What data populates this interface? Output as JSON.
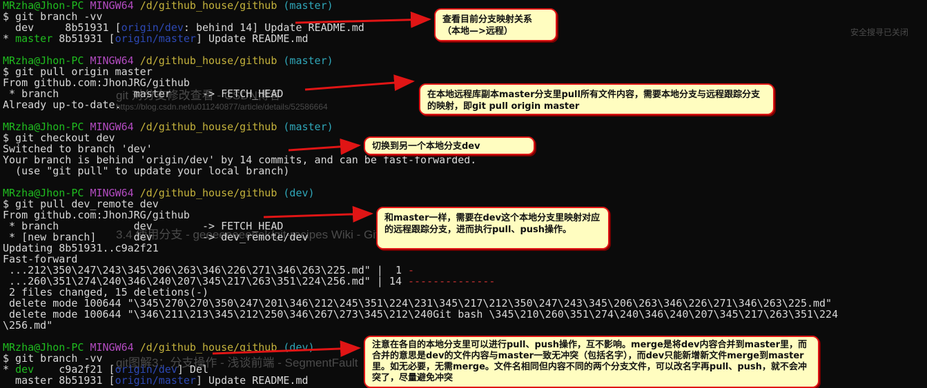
{
  "terminal": {
    "lines": [
      {
        "name": "prompt-line",
        "segs": [
          [
            "MRzha@Jhon-PC ",
            "g"
          ],
          [
            "MINGW64 ",
            "m"
          ],
          [
            "/d/github_house/github ",
            "y"
          ],
          [
            "(master)",
            "c"
          ]
        ]
      },
      {
        "name": "command-line",
        "segs": [
          [
            "$ git branch -vv",
            "w"
          ]
        ]
      },
      {
        "name": "output-line",
        "segs": [
          [
            "  dev     8b51931 [",
            "w"
          ],
          [
            "origin/dev",
            "b"
          ],
          [
            ": behind 14] Update README.md",
            "w"
          ]
        ]
      },
      {
        "name": "output-line",
        "segs": [
          [
            "* ",
            "w"
          ],
          [
            "master",
            "g"
          ],
          [
            " 8b51931 [",
            "w"
          ],
          [
            "origin/master",
            "b"
          ],
          [
            "] Update README.md",
            "w"
          ]
        ]
      },
      {
        "name": "blank-line",
        "segs": []
      },
      {
        "name": "prompt-line",
        "segs": [
          [
            "MRzha@Jhon-PC ",
            "g"
          ],
          [
            "MINGW64 ",
            "m"
          ],
          [
            "/d/github_house/github ",
            "y"
          ],
          [
            "(master)",
            "c"
          ]
        ]
      },
      {
        "name": "command-line",
        "segs": [
          [
            "$ git pull origin master",
            "w"
          ]
        ]
      },
      {
        "name": "output-line",
        "segs": [
          [
            "From github.com:JhonJRG/github",
            "w"
          ]
        ]
      },
      {
        "name": "output-line",
        "segs": [
          [
            " * branch            master     -> FETCH_HEAD",
            "w"
          ]
        ]
      },
      {
        "name": "output-line",
        "segs": [
          [
            "Already up-to-date.",
            "w"
          ]
        ]
      },
      {
        "name": "blank-line",
        "segs": []
      },
      {
        "name": "prompt-line",
        "segs": [
          [
            "MRzha@Jhon-PC ",
            "g"
          ],
          [
            "MINGW64 ",
            "m"
          ],
          [
            "/d/github_house/github ",
            "y"
          ],
          [
            "(master)",
            "c"
          ]
        ]
      },
      {
        "name": "command-line",
        "segs": [
          [
            "$ git checkout dev",
            "w"
          ]
        ]
      },
      {
        "name": "output-line",
        "segs": [
          [
            "Switched to branch 'dev'",
            "w"
          ]
        ]
      },
      {
        "name": "output-line",
        "segs": [
          [
            "Your branch is behind 'origin/dev' by 14 commits, and can be fast-forwarded.",
            "w"
          ]
        ]
      },
      {
        "name": "output-line",
        "segs": [
          [
            "  (use \"git pull\" to update your local branch)",
            "w"
          ]
        ]
      },
      {
        "name": "blank-line",
        "segs": []
      },
      {
        "name": "prompt-line",
        "segs": [
          [
            "MRzha@Jhon-PC ",
            "g"
          ],
          [
            "MINGW64 ",
            "m"
          ],
          [
            "/d/github_house/github ",
            "y"
          ],
          [
            "(dev)",
            "c"
          ]
        ]
      },
      {
        "name": "command-line",
        "segs": [
          [
            "$ git pull dev_remote dev",
            "w"
          ]
        ]
      },
      {
        "name": "output-line",
        "segs": [
          [
            "From github.com:JhonJRG/github",
            "w"
          ]
        ]
      },
      {
        "name": "output-line",
        "segs": [
          [
            " * branch            dev        -> FETCH_HEAD",
            "w"
          ]
        ]
      },
      {
        "name": "output-line",
        "segs": [
          [
            " * [new branch]      dev        -> dev_remote/dev",
            "w"
          ]
        ]
      },
      {
        "name": "output-line",
        "segs": [
          [
            "Updating 8b51931..c9a2f21",
            "w"
          ]
        ]
      },
      {
        "name": "output-line",
        "segs": [
          [
            "Fast-forward",
            "w"
          ]
        ]
      },
      {
        "name": "output-line",
        "segs": [
          [
            " ...212\\350\\247\\243\\345\\206\\263\\346\\226\\271\\346\\263\\225.md\" |  1 ",
            "w"
          ],
          [
            "-",
            "r"
          ]
        ]
      },
      {
        "name": "output-line",
        "segs": [
          [
            " ...260\\351\\274\\240\\346\\240\\207\\345\\217\\263\\351\\224\\256.md\" | 14 ",
            "w"
          ],
          [
            "--------------",
            "r"
          ]
        ]
      },
      {
        "name": "output-line",
        "segs": [
          [
            " 2 files changed, 15 deletions(-)",
            "w"
          ]
        ]
      },
      {
        "name": "output-line",
        "segs": [
          [
            " delete mode 100644 \"\\345\\270\\270\\350\\247\\201\\346\\212\\245\\351\\224\\231\\345\\217\\212\\350\\247\\243\\345\\206\\263\\346\\226\\271\\346\\263\\225.md\"",
            "w"
          ]
        ]
      },
      {
        "name": "output-line",
        "segs": [
          [
            " delete mode 100644 \"\\346\\211\\213\\345\\212\\250\\346\\267\\273\\345\\212\\240Git bash \\345\\210\\260\\351\\274\\240\\346\\240\\207\\345\\217\\263\\351\\224",
            "w"
          ]
        ]
      },
      {
        "name": "output-line",
        "segs": [
          [
            "\\256.md\"",
            "w"
          ]
        ]
      },
      {
        "name": "blank-line",
        "segs": []
      },
      {
        "name": "prompt-line",
        "segs": [
          [
            "MRzha@Jhon-PC ",
            "g"
          ],
          [
            "MINGW64 ",
            "m"
          ],
          [
            "/d/github_house/github ",
            "y"
          ],
          [
            "(dev)",
            "c"
          ]
        ]
      },
      {
        "name": "command-line",
        "segs": [
          [
            "$ git branch -vv",
            "w"
          ]
        ]
      },
      {
        "name": "output-line",
        "segs": [
          [
            "* ",
            "w"
          ],
          [
            "dev",
            "g"
          ],
          [
            "    c9a2f21 [",
            "w"
          ],
          [
            "origin/dev",
            "b"
          ],
          [
            "] Del",
            "w"
          ]
        ]
      },
      {
        "name": "output-line",
        "segs": [
          [
            "  master 8b51931 [",
            "w"
          ],
          [
            "origin/master",
            "b"
          ],
          [
            "] Update README.md",
            "w"
          ]
        ]
      }
    ]
  },
  "ghost_text": {
    "title": "git 对分支修改查看 - CSDN博客",
    "url": "https://blog.csdn.net/u011240877/article/details/52586664",
    "title2": "3.4 使用分支 - geeeeeeeeeek/git-recipes Wiki - GitHub",
    "title3": "git图解3：分支操作 - 浅谈前端 - SegmentFault",
    "safe": "安全搜寻已关闭"
  },
  "callouts": {
    "c1": "查看目前分支映射关系（本地—>远程）",
    "c2": "在本地远程库副本master分支里pull所有文件内容，需要本地分支与远程跟踪分支的映射，即git pull origin master",
    "c3": "切换到另一个本地分支dev",
    "c4": "和master一样，需要在dev这个本地分支里映射对应的远程跟踪分支，进而执行pull、push操作。",
    "c5": "注意在各自的本地分支里可以进行pull、push操作，互不影响。merge是将dev内容合并到master里，而合并的意思是dev的文件内容与master一致无冲突（包括名字），而dev只能新增新文件merge到master里。如无必要，无需merge。文件名相同但内容不同的两个分支文件，可以改名字再pull、push，就不会冲突了，尽量避免冲突"
  },
  "colors": {
    "terminal_bg": "#0b0b0b",
    "prompt_user": "#1fbd1f",
    "prompt_mingw": "#b24bc0",
    "prompt_path": "#c4b23c",
    "prompt_branch": "#2fa6b8",
    "remote_branch": "#2d49b5",
    "callout_bg": "#fffdc0",
    "callout_border": "#e01515"
  }
}
